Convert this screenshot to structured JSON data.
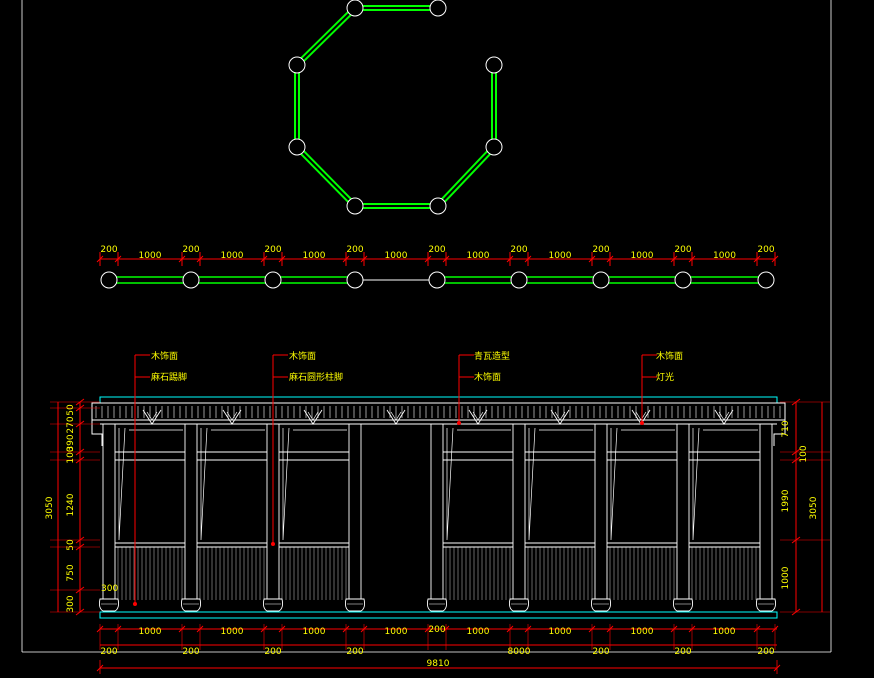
{
  "colors": {
    "background": "#000000",
    "green": "#00ff00",
    "red": "#ff0000",
    "yellow": "#ffff00",
    "white": "#ffffff",
    "cyan": "#00ffff"
  },
  "plan": {
    "top_labels": [
      "200",
      "1000",
      "200",
      "1000",
      "200",
      "1000",
      "200",
      "1000",
      "200",
      "1000",
      "200",
      "1000",
      "200",
      "1000",
      "200",
      "1000",
      "200"
    ]
  },
  "callouts": [
    {
      "labels": [
        "木饰面",
        "麻石踢脚"
      ]
    },
    {
      "labels": [
        "木饰面",
        "麻石圆形柱脚"
      ]
    },
    {
      "labels": [
        "青瓦造型",
        "木饰面"
      ]
    },
    {
      "labels": [
        "木饰面",
        "灯光"
      ]
    }
  ],
  "left_dims": [
    "50",
    "270",
    "390",
    "100",
    "1240",
    "50",
    "750",
    "300"
  ],
  "left_total": "3050",
  "right_dims": [
    "710",
    "100",
    "1990",
    "1000"
  ],
  "right_total": "3050",
  "small_label": "300",
  "bottom_row1": [
    "1000",
    "1000",
    "1000",
    "1000",
    "200",
    "1000",
    "1000",
    "1000",
    "1000"
  ],
  "bottom_row2": [
    "200",
    "200",
    "200",
    "200",
    "8000",
    "200",
    "200",
    "200"
  ],
  "total": "9810"
}
